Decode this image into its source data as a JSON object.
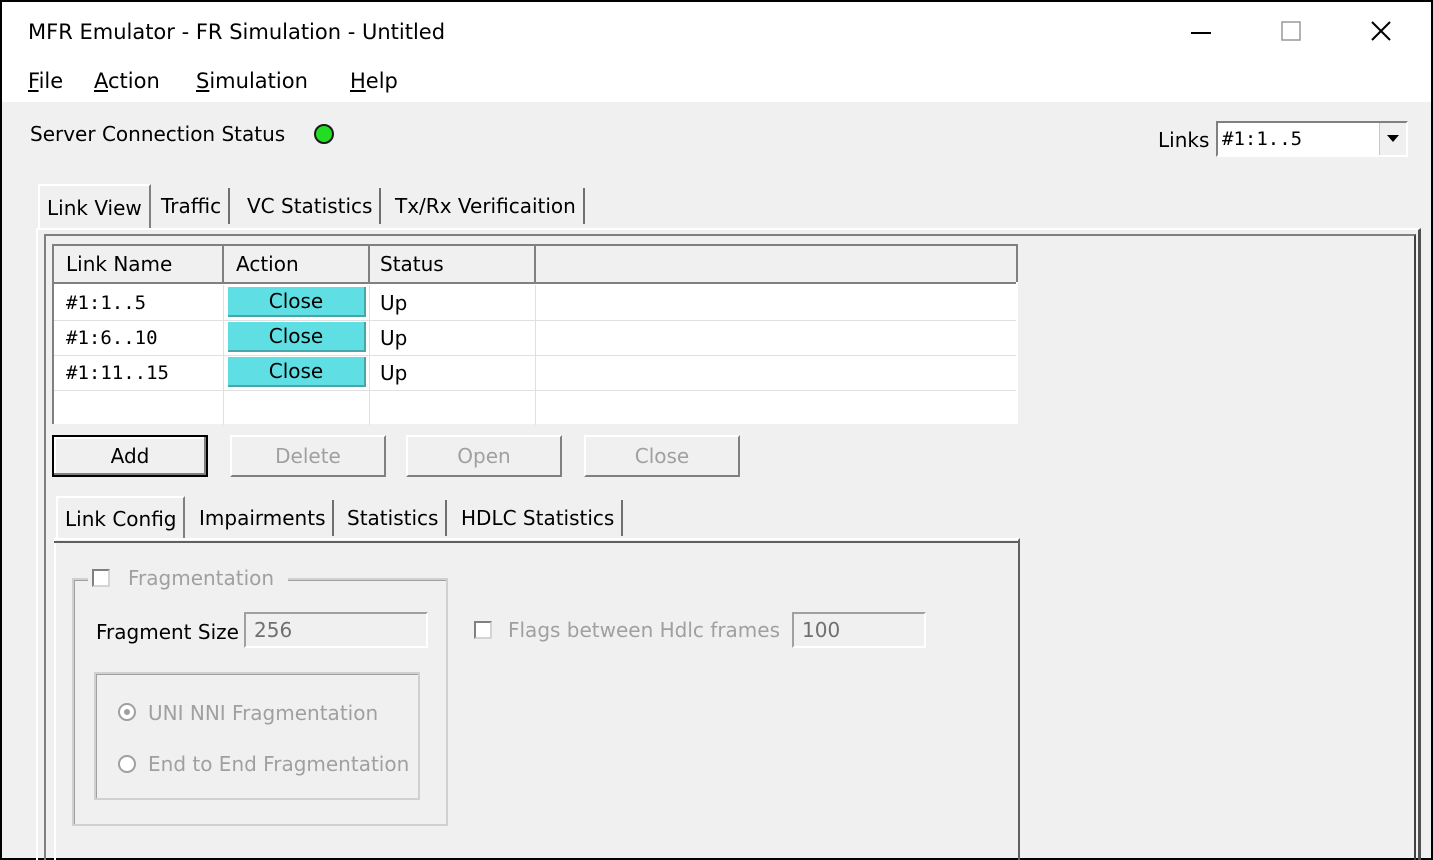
{
  "window": {
    "title": "MFR Emulator - FR Simulation - Untitled",
    "minimize_glyph": "—",
    "maximize_glyph": "☐",
    "close_glyph": "✕"
  },
  "menu": [
    {
      "accel": "F",
      "rest": "ile"
    },
    {
      "accel": "A",
      "rest": "ction"
    },
    {
      "accel": "S",
      "rest": "imulation"
    },
    {
      "accel": "H",
      "rest": "elp"
    }
  ],
  "status": {
    "label": "Server Connection Status",
    "led_color": "#22dd22"
  },
  "links_selector": {
    "label": "Links",
    "value": "#1:1..5",
    "arrow": "▼"
  },
  "main_tabs": [
    "Link View",
    "Traffic",
    "VC Statistics",
    "Tx/Rx Verificaition"
  ],
  "link_table": {
    "columns": [
      "Link Name",
      "Action",
      "Status"
    ],
    "rows": [
      {
        "name": "#1:1..5",
        "action": "Close",
        "status": "Up"
      },
      {
        "name": "#1:6..10",
        "action": "Close",
        "status": "Up"
      },
      {
        "name": "#1:11..15",
        "action": "Close",
        "status": "Up"
      }
    ],
    "action_color": "#5fdfe4"
  },
  "buttons": {
    "add": "Add",
    "delete": "Delete",
    "open": "Open",
    "close": "Close"
  },
  "sub_tabs": [
    "Link Config",
    "Impairments",
    "Statistics",
    "HDLC Statistics"
  ],
  "link_config": {
    "fragmentation_label": "Fragmentation",
    "fragment_size_label": "Fragment Size",
    "fragment_size_value": "256",
    "radio_uni_nni": "UNI NNI Fragmentation",
    "radio_end_to_end": "End to End Fragmentation",
    "flags_label": "Flags between Hdlc frames",
    "flags_value": "100"
  }
}
